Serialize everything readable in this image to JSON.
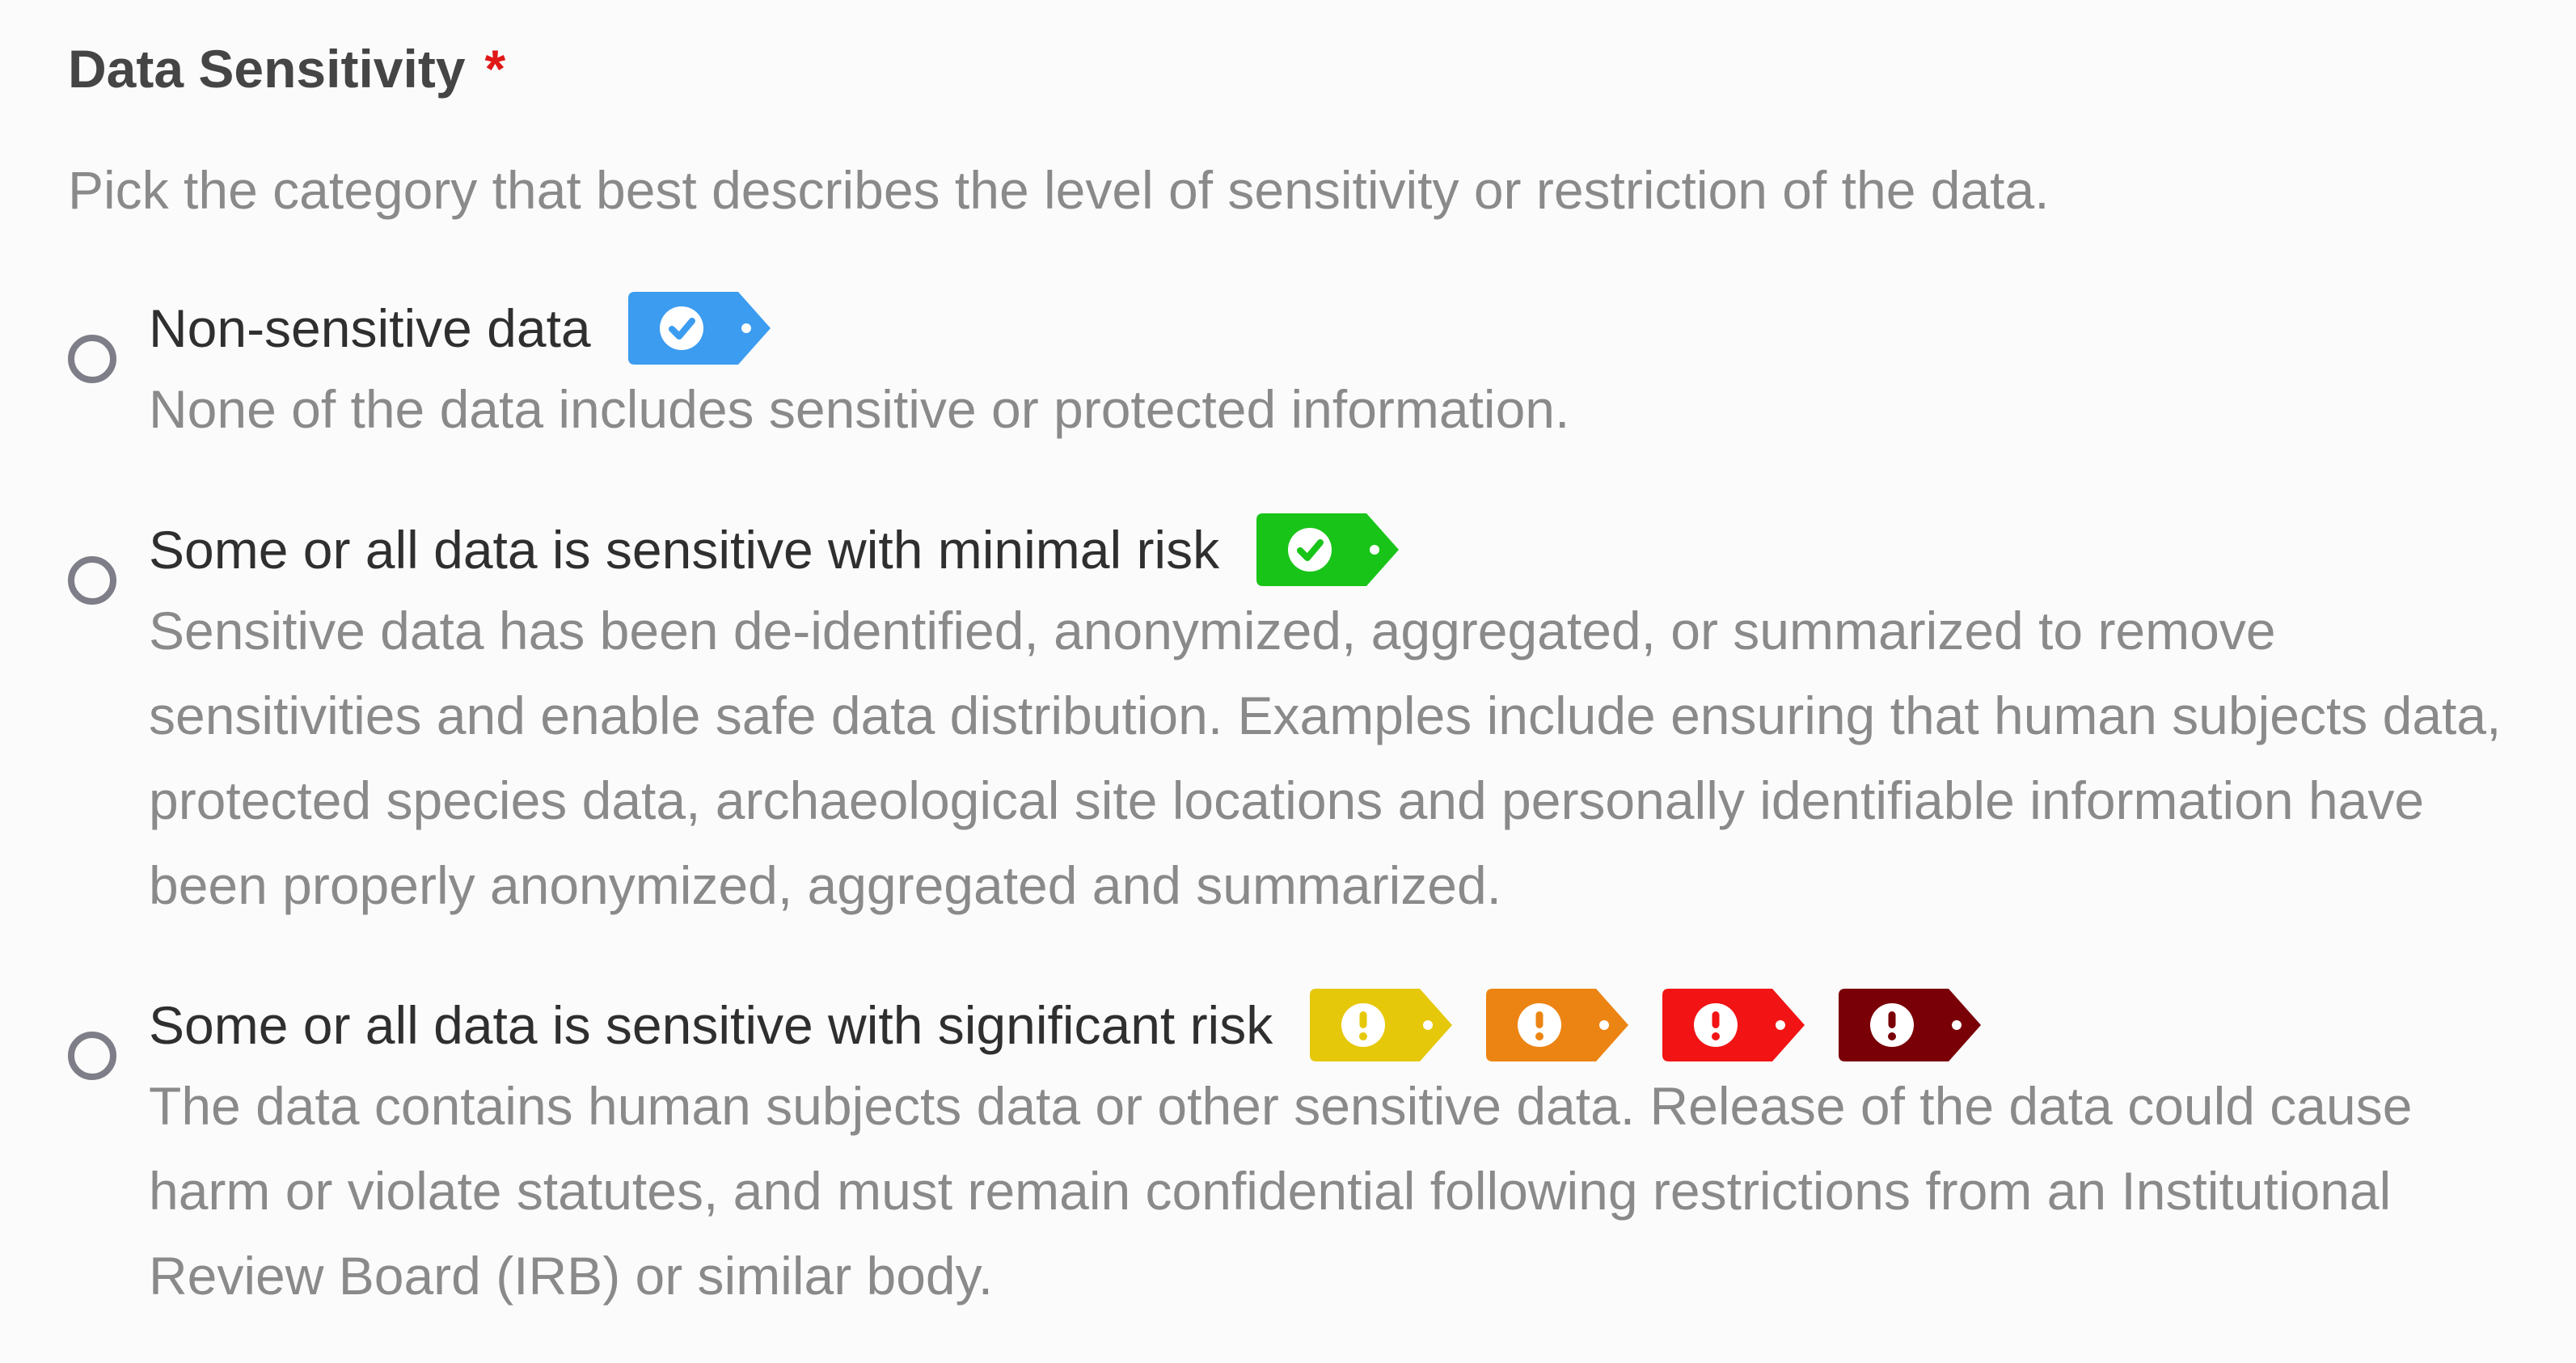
{
  "field": {
    "title": "Data Sensitivity",
    "required_mark": "*",
    "help": "Pick the category that best describes the level of sensitivity or restriction of the data."
  },
  "options": [
    {
      "label": "Non-sensitive data",
      "description": "None of the data includes sensitive or protected information.",
      "selected": false,
      "tags": [
        {
          "icon": "check-circle-icon",
          "color": "#3b9cf0"
        }
      ]
    },
    {
      "label": "Some or all data is sensitive with minimal risk",
      "description": "Sensitive data has been de-identified, anonymized, aggregated, or summarized to remove sensitivities and enable safe data distribution. Examples include ensuring that human subjects data, protected species data, archaeological site locations and personally identifiable information have been properly anonymized, aggregated and summarized.",
      "selected": false,
      "tags": [
        {
          "icon": "check-circle-icon",
          "color": "#19c419"
        }
      ]
    },
    {
      "label": "Some or all data is sensitive with significant risk",
      "description": "The data contains human subjects data or other sensitive data. Release of the data could cause harm or violate statutes, and must remain confidential following restrictions from an Institutional Review Board (IRB) or similar body.",
      "selected": false,
      "tags": [
        {
          "icon": "exclamation-circle-icon",
          "color": "#e6c80a"
        },
        {
          "icon": "exclamation-circle-icon",
          "color": "#ec8413"
        },
        {
          "icon": "exclamation-circle-icon",
          "color": "#f21414"
        },
        {
          "icon": "exclamation-circle-icon",
          "color": "#7a0008"
        }
      ]
    }
  ]
}
